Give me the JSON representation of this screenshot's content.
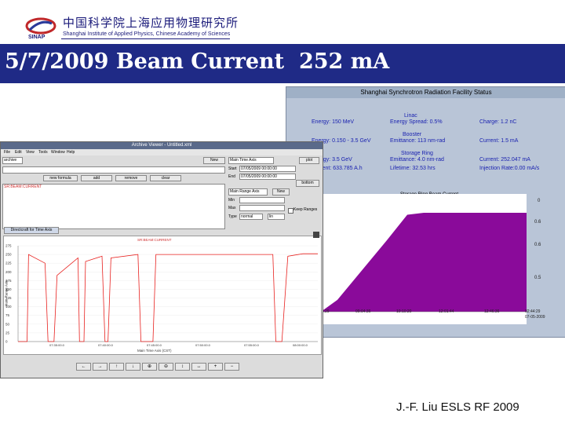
{
  "header": {
    "cn_title": "中国科学院上海应用物理研究所",
    "en_subtitle": "Shanghai Institute of Applied Physics, Chinese Academy of Sciences",
    "logo_text": "SINAP",
    "slide_title": "5/7/2009 Beam Current  252 mA",
    "title_bar_color": "#1f2a86"
  },
  "footer": {
    "credit": "J.-F. Liu ESLS RF 2009"
  },
  "status_window": {
    "title": "Shanghai Synchrotron Radiation Facility Status",
    "linac": {
      "heading": "Linac",
      "energy": "Energy: 150 MeV",
      "energy_spread": "Energy Spread: 0.5%",
      "charge": "Charge: 1.2 nC"
    },
    "booster": {
      "heading": "Booster",
      "energy": "Energy: 0.150 - 3.5 GeV",
      "emittance": "Emittance: 113 nm-rad",
      "current": "Current: 1.5 mA"
    },
    "storage_ring": {
      "heading": "Storage Ring",
      "energy": "Energy: 3.5 GeV",
      "emittance": "Emittance: 4.0 nm-rad",
      "current": "Current: 252.047 mA",
      "beam_current": "Current: 633.785 A.h",
      "lifetime": "Lifetime: 32.53 hrs",
      "injection_rate": "Injection Rate:0.00 mA/s"
    },
    "plot_title": "Storage Ring Beam Current",
    "y_ticks": [
      "0",
      "0.6",
      "0.6",
      "0.5"
    ],
    "x_ticks": [
      "08:29",
      "09:04:36",
      "10:10:20",
      "12:01:44",
      "12:46:36",
      "02:44:29"
    ],
    "x_tick_dates": [
      "07-05-2009",
      "07-05-2009"
    ],
    "fill_color": "#8a0a9a",
    "chart_data": {
      "type": "area",
      "title": "Storage Ring Beam Current",
      "x": [
        0.0,
        0.08,
        0.32,
        0.42,
        0.5,
        0.62,
        0.85,
        1.0
      ],
      "values": [
        0.0,
        0.12,
        0.72,
        0.98,
        1.0,
        1.0,
        1.0,
        1.0
      ]
    }
  },
  "viewer_window": {
    "title": "Archive Viewer - Untitled.xml",
    "menu": [
      "File",
      "Edit",
      "View",
      "Tools",
      "Window",
      "Help"
    ],
    "archive_select": "archive",
    "search_button": "search",
    "name_field": "SR:BEAM:CURRENT",
    "buttons": {
      "new_formula": "new formula",
      "add": "add",
      "remove": "remove",
      "clear": "clear",
      "plot": "plot",
      "new": "New",
      "bottom": "bottom"
    },
    "time_axis": "Main Time Axis",
    "start_label": "Start",
    "start_value": "07/05/2009 00:00:00",
    "end_label": "End",
    "end_value": "07/05/2009 00:00:00",
    "range_axis": "Main Range Axis",
    "min_label": "Min",
    "max_label": "Max",
    "type_label": "Type",
    "type_value": "normal",
    "type_scale": "lin",
    "keep_ranges": "Keep Ranges",
    "tab_label": "Directcraft for Time Axis",
    "legend_entry": "SR:BEAM:CURRENT",
    "y_axis_label": "Main Range Axis",
    "x_axis_label": "Main Time Axis (CST)",
    "series_color": "#e8201e",
    "y_ticks": [
      "275",
      "250",
      "225",
      "200",
      "175",
      "150",
      "125",
      "100",
      "75",
      "50",
      "25",
      "0"
    ],
    "x_ticks": [
      "07:35:00.0",
      "07:40:00.0",
      "07:45:00.0",
      "07:50:00.0",
      "07:55:00.0",
      "08:00:00.0"
    ],
    "x_tick_dates": [
      "07/05",
      "07/05",
      "07/05",
      "07/05",
      "07/05",
      "07/05"
    ],
    "nav_buttons": [
      "←",
      "→",
      "↑",
      "↓",
      "⊕",
      "⊖",
      "↕",
      "↔",
      "+",
      "−"
    ],
    "chart_data": {
      "type": "line",
      "series": [
        {
          "name": "SR:BEAM:CURRENT",
          "x": [
            0.0,
            0.03,
            0.035,
            0.09,
            0.1,
            0.12,
            0.13,
            0.2,
            0.205,
            0.22,
            0.225,
            0.28,
            0.29,
            0.3,
            0.31,
            0.4,
            0.41,
            0.45,
            0.46,
            0.85,
            0.86,
            0.88,
            0.9,
            0.95,
            1.0
          ],
          "values": [
            0,
            0,
            250,
            225,
            0,
            0,
            190,
            240,
            0,
            0,
            230,
            245,
            0,
            0,
            240,
            250,
            0,
            0,
            250,
            250,
            0,
            0,
            245,
            252,
            252
          ]
        }
      ],
      "ylim": [
        0,
        275
      ],
      "xlabel": "Main Time Axis (CST)",
      "ylabel": "Main Range Axis"
    }
  }
}
